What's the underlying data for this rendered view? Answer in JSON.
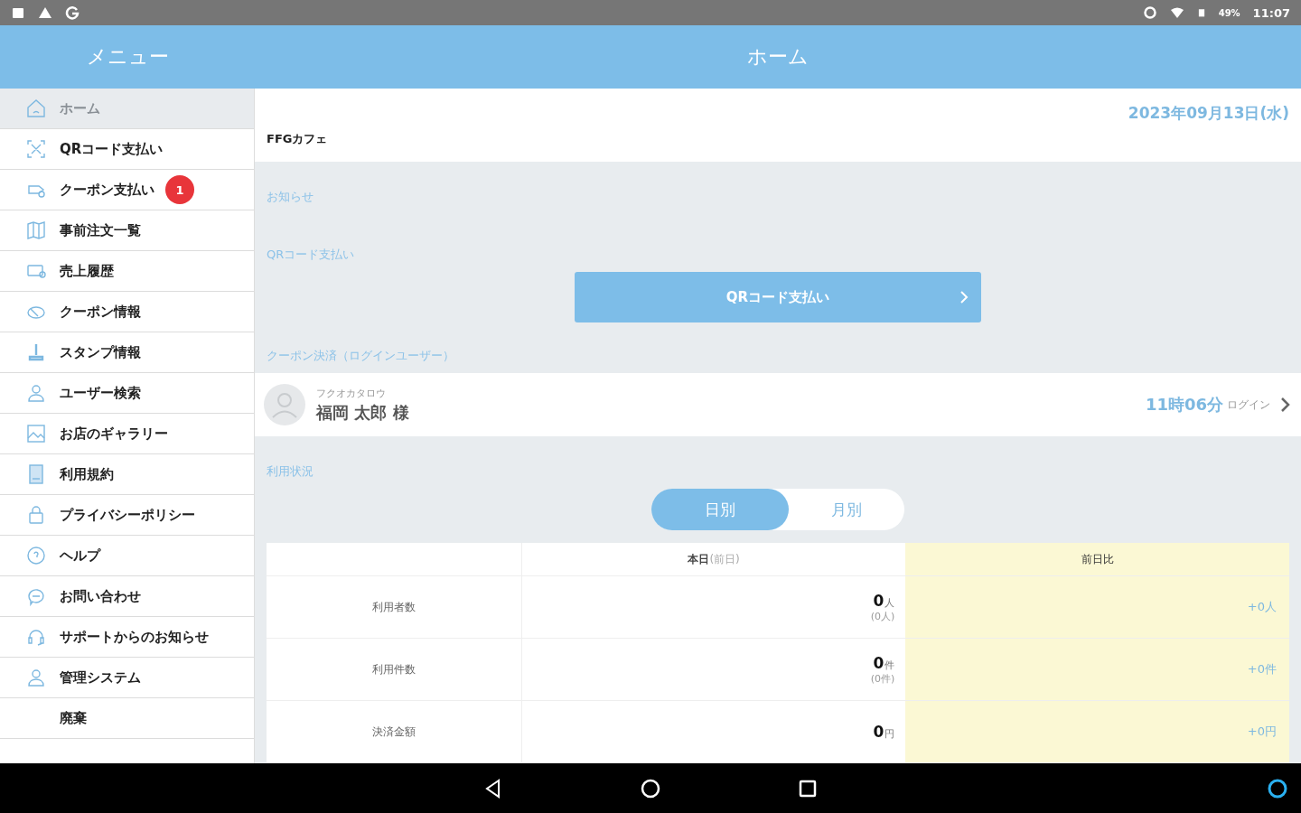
{
  "status_bar": {
    "battery": "49%",
    "time": "11:07"
  },
  "sidebar": {
    "title": "メニュー",
    "items": [
      {
        "label": "ホーム",
        "selected": true
      },
      {
        "label": "QRコード支払い",
        "selected": false
      },
      {
        "label": "クーポン支払い",
        "selected": false,
        "badge": "1"
      },
      {
        "label": "事前注文一覧",
        "selected": false
      },
      {
        "label": "売上履歴",
        "selected": false
      },
      {
        "label": "クーポン情報",
        "selected": false
      },
      {
        "label": "スタンプ情報",
        "selected": false
      },
      {
        "label": "ユーザー検索",
        "selected": false
      },
      {
        "label": "お店のギャラリー",
        "selected": false
      },
      {
        "label": "利用規約",
        "selected": false
      },
      {
        "label": "プライバシーポリシー",
        "selected": false
      },
      {
        "label": "ヘルプ",
        "selected": false
      },
      {
        "label": "お問い合わせ",
        "selected": false
      },
      {
        "label": "サポートからのお知らせ",
        "selected": false
      },
      {
        "label": "管理システム",
        "selected": false
      },
      {
        "label": "廃棄",
        "selected": false
      }
    ]
  },
  "header": {
    "title": "ホーム"
  },
  "home": {
    "date": "2023年09月13日(水)",
    "shop_name": "FFGカフェ",
    "notice": {
      "heading": "お知らせ"
    },
    "qr_payment": {
      "heading": "QRコード支払い",
      "button": "QRコード支払い"
    },
    "coupon_payment": {
      "heading": "クーポン決済（ログインユーザー）",
      "users": [
        {
          "kana": "フクオカタロウ",
          "name": "福岡 太郎 様",
          "time": "11時06分",
          "time_note": "ログイン"
        }
      ]
    },
    "usage": {
      "heading": "利用状況",
      "tabs": [
        {
          "label": "日別",
          "selected": true
        },
        {
          "label": "月別",
          "selected": false
        }
      ],
      "table": {
        "columns": [
          {
            "label": "本日",
            "note": "(前日)"
          },
          {
            "label": "前日比"
          }
        ],
        "rows": [
          {
            "label": "利用者数",
            "value": "0",
            "unit": "人",
            "previous": "(0人)",
            "diff": "+0人"
          },
          {
            "label": "利用件数",
            "value": "0",
            "unit": "件",
            "previous": "(0件)",
            "diff": "+0件"
          },
          {
            "label": "決済金額",
            "value": "0",
            "unit": "円",
            "diff": "+0円"
          }
        ]
      }
    }
  }
}
